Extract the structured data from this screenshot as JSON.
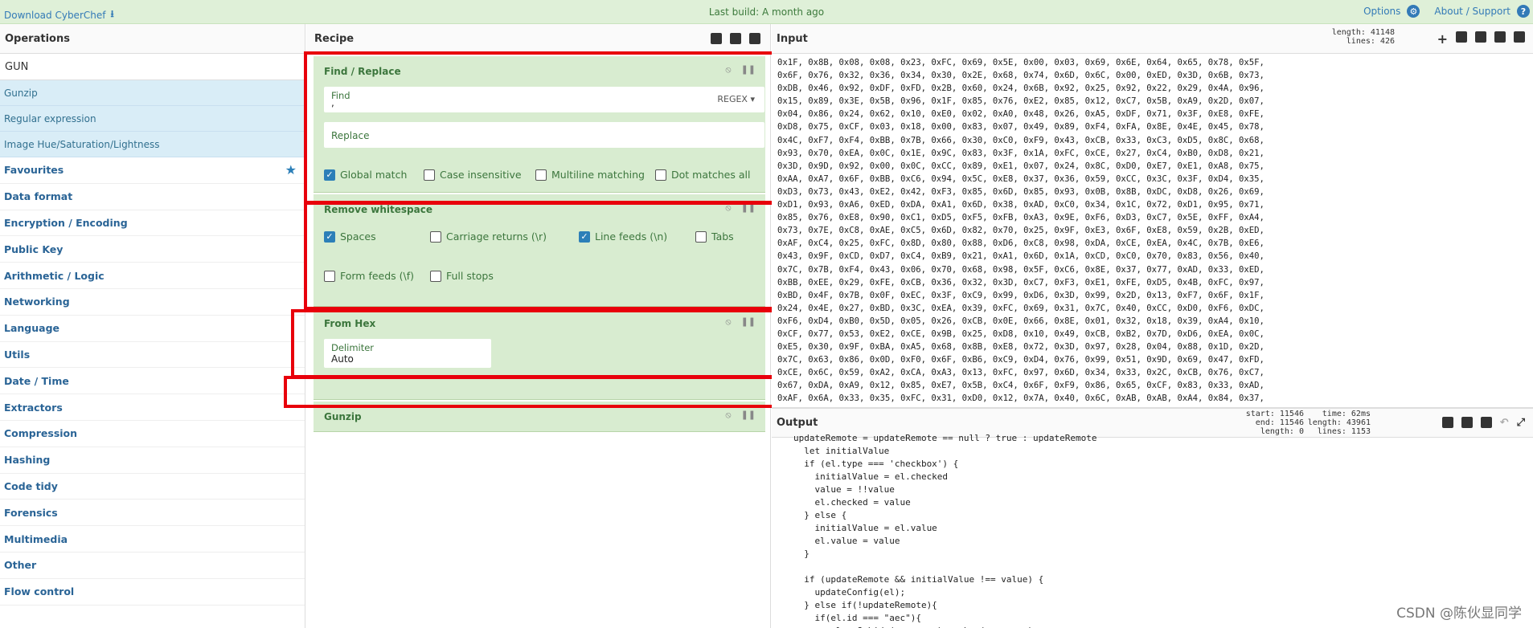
{
  "topbar": {
    "download": "Download CyberChef",
    "build": "Last build: A month ago",
    "options": "Options",
    "about": "About / Support"
  },
  "operations": {
    "title": "Operations",
    "search_value": "GUN",
    "results": [
      "Gunzip",
      "Regular expression",
      "Image Hue/Saturation/Lightness"
    ],
    "categories": [
      "Favourites",
      "Data format",
      "Encryption / Encoding",
      "Public Key",
      "Arithmetic / Logic",
      "Networking",
      "Language",
      "Utils",
      "Date / Time",
      "Extractors",
      "Compression",
      "Hashing",
      "Code tidy",
      "Forensics",
      "Multimedia",
      "Other",
      "Flow control"
    ]
  },
  "recipe": {
    "title": "Recipe",
    "find_replace": {
      "title": "Find / Replace",
      "find_label": "Find",
      "find_value": ",",
      "regex": "REGEX",
      "replace_label": "Replace",
      "global": "Global match",
      "case": "Case insensitive",
      "multiline": "Multiline matching",
      "dotall": "Dot matches all"
    },
    "whitespace": {
      "title": "Remove whitespace",
      "spaces": "Spaces",
      "cr": "Carriage returns (\\r)",
      "lf": "Line feeds (\\n)",
      "tabs": "Tabs",
      "ff": "Form feeds (\\f)",
      "stops": "Full stops"
    },
    "from_hex": {
      "title": "From Hex",
      "delim_label": "Delimiter",
      "delim_value": "Auto"
    },
    "gunzip": {
      "title": "Gunzip"
    }
  },
  "input": {
    "title": "Input",
    "length": "length: 41148",
    "lines": "lines:   426",
    "lines_text": [
      "0x1F, 0x8B, 0x08, 0x08, 0x23, 0xFC, 0x69, 0x5E, 0x00, 0x03, 0x69, 0x6E, 0x64, 0x65, 0x78, 0x5F,",
      "0x6F, 0x76, 0x32, 0x36, 0x34, 0x30, 0x2E, 0x68, 0x74, 0x6D, 0x6C, 0x00, 0xED, 0x3D, 0x6B, 0x73,",
      "0xDB, 0x46, 0x92, 0xDF, 0xFD, 0x2B, 0x60, 0x24, 0x6B, 0x92, 0x25, 0x92, 0x22, 0x29, 0x4A, 0x96,",
      "0x15, 0x89, 0x3E, 0x5B, 0x96, 0x1F, 0x85, 0x76, 0xE2, 0x85, 0x12, 0xC7, 0x5B, 0xA9, 0x2D, 0x07,",
      "0x04, 0x86, 0x24, 0x62, 0x10, 0xE0, 0x02, 0xA0, 0x48, 0x26, 0xA5, 0xDF, 0x71, 0x3F, 0xE8, 0xFE,",
      "0xD8, 0x75, 0xCF, 0x03, 0x18, 0x00, 0x83, 0x07, 0x49, 0x89, 0xF4, 0xFA, 0x8E, 0x4E, 0x45, 0x78,",
      "0x4C, 0xF7, 0xF4, 0xBB, 0x7B, 0x66, 0x30, 0xC0, 0xF9, 0x43, 0xCB, 0x33, 0xC3, 0xD5, 0x8C, 0x68,",
      "0x93, 0x70, 0xEA, 0x0C, 0x1E, 0x9C, 0x83, 0x3F, 0x1A, 0xFC, 0xCE, 0x27, 0xC4, 0xB0, 0xD8, 0x21,",
      "0x3D, 0x9D, 0x92, 0x00, 0x0C, 0xCC, 0x89, 0xE1, 0x07, 0x24, 0x8C, 0xD0, 0xE7, 0xE1, 0xA8, 0x75,",
      "0xAA, 0xA7, 0x6F, 0xBB, 0xC6, 0x94, 0x5C, 0xE8, 0x37, 0x36, 0x59, 0xCC, 0x3C, 0x3F, 0xD4, 0x35,",
      "0xD3, 0x73, 0x43, 0xE2, 0x42, 0xF3, 0x85, 0x6D, 0x85, 0x93, 0x0B, 0x8B, 0xDC, 0xD8, 0x26, 0x69,",
      "0xD1, 0x93, 0xA6, 0xED, 0xDA, 0xA1, 0x6D, 0x38, 0xAD, 0xC0, 0x34, 0x1C, 0x72, 0xD1, 0x95, 0x71,",
      "0x85, 0x76, 0xE8, 0x90, 0xC1, 0xD5, 0xF5, 0xFB, 0xA3, 0x9E, 0xF6, 0xD3, 0xC7, 0x5E, 0xFF, 0xA4,",
      "0x73, 0x7E, 0xC8, 0xAE, 0xC5, 0x6D, 0x82, 0x70, 0x25, 0x9F, 0xE3, 0x6F, 0xE8, 0x59, 0x2B, 0xED,",
      "0xAF, 0xC4, 0x25, 0xFC, 0x8D, 0x80, 0x88, 0xD6, 0xC8, 0x98, 0xDA, 0xCE, 0xEA, 0x4C, 0x7B, 0xE6,",
      "0x43, 0x9F, 0xCD, 0xD7, 0xC4, 0xB9, 0x21, 0xA1, 0x6D, 0x1A, 0xCD, 0xC0, 0x70, 0x83, 0x56, 0x40,",
      "0x7C, 0x7B, 0xF4, 0x43, 0x06, 0x70, 0x68, 0x98, 0x5F, 0xC6, 0x8E, 0x37, 0x77, 0xAD, 0x33, 0xED,",
      "0xBB, 0xEE, 0x29, 0xFE, 0xCB, 0x36, 0x32, 0x3D, 0xC7, 0xF3, 0xE1, 0xFE, 0xD5, 0x4B, 0xFC, 0x97,",
      "0xBD, 0x4F, 0x7B, 0x0F, 0xEC, 0x3F, 0xC9, 0x99, 0xD6, 0x3D, 0x99, 0x2D, 0x13, 0xF7, 0x6F, 0x1F,",
      "0x24, 0x4E, 0x27, 0xBD, 0x3C, 0xEA, 0x39, 0xFC, 0x69, 0x31, 0x7C, 0x40, 0xCC, 0xD0, 0xF6, 0xDC,",
      "0xF6, 0xD4, 0xB0, 0x5D, 0x05, 0x26, 0xCB, 0x0E, 0x66, 0x8E, 0x01, 0x32, 0x18, 0x39, 0xA4, 0x10,",
      "0xCF, 0x77, 0x53, 0xE2, 0xCE, 0x9B, 0x25, 0xD8, 0x10, 0x49, 0xCB, 0xB2, 0x7D, 0xD6, 0xEA, 0x0C,",
      "0xE5, 0x30, 0x9F, 0xBA, 0xA5, 0x68, 0x8B, 0xE8, 0x72, 0x3D, 0x97, 0x28, 0x04, 0x88, 0x1D, 0x2D,",
      "0x7C, 0x63, 0x86, 0x0D, 0xF0, 0x6F, 0xB6, 0xC9, 0xD4, 0x76, 0x99, 0x51, 0x9D, 0x69, 0x47, 0xFD,",
      "0xCE, 0x6C, 0x59, 0xA2, 0xCA, 0xA3, 0x13, 0xFC, 0x97, 0x6D, 0x34, 0x33, 0x2C, 0xCB, 0x76, 0xC7,",
      "0x67, 0xDA, 0xA9, 0x12, 0x85, 0xE7, 0x5B, 0xC4, 0x6F, 0xF9, 0x86, 0x65, 0xCF, 0x83, 0x33, 0xAD,",
      "0xAF, 0x6A, 0x33, 0x35, 0xFC, 0x31, 0xD0, 0x12, 0x7A, 0x40, 0x6C, 0xAB, 0xAB, 0xA4, 0x84, 0x37,"
    ]
  },
  "output": {
    "title": "Output",
    "start": "start: 11546",
    "end": "end: 11546",
    "length": "length:     0",
    "time": "time:   62ms",
    "olength": "length: 43961",
    "olines": "lines:  1153",
    "code": "updateRemote = updateRemote == null ? true : updateRemote\n  let initialValue\n  if (el.type === 'checkbox') {\n    initialValue = el.checked\n    value = !!value\n    el.checked = value\n  } else {\n    initialValue = el.value\n    el.value = value\n  }\n\n  if (updateRemote && initialValue !== value) {\n    updateConfig(el);\n  } else if(!updateRemote){\n    if(el.id === \"aec\"){\n      value ? hide(exposure) : show(exposure)"
  },
  "watermark": "CSDN @陈伙显同学"
}
